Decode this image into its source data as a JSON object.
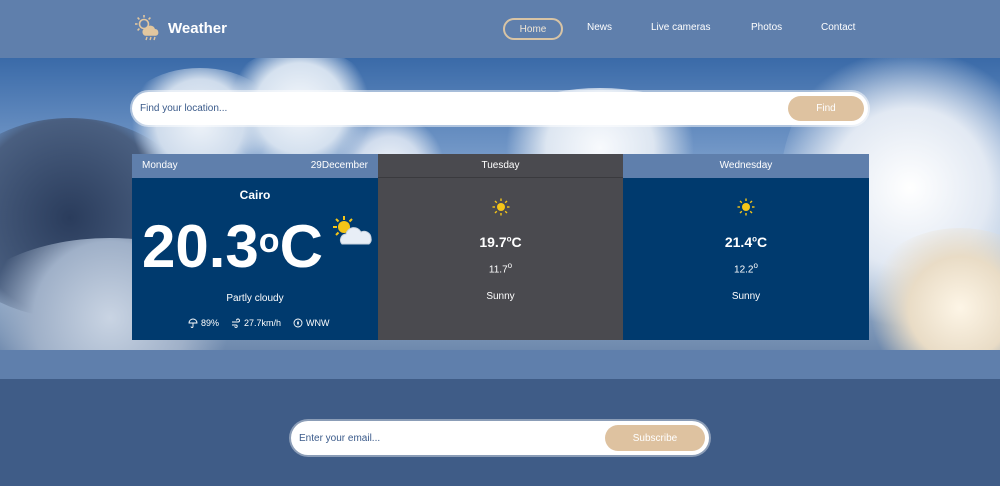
{
  "header": {
    "brand": "Weather",
    "nav": [
      {
        "label": "Home",
        "active": true
      },
      {
        "label": "News"
      },
      {
        "label": "Live cameras"
      },
      {
        "label": "Photos"
      },
      {
        "label": "Contact"
      }
    ]
  },
  "search": {
    "placeholder": "Find your location...",
    "button": "Find"
  },
  "forecast": {
    "today": {
      "day": "Monday",
      "date": "29December",
      "city": "Cairo",
      "temp": "20.3",
      "unit": "C",
      "condition": "Partly cloudy",
      "humidity": "89%",
      "wind_speed": "27.7km/h",
      "wind_dir": "WNW"
    },
    "days": [
      {
        "day": "Tuesday",
        "max": "19.7",
        "unit": "C",
        "min": "11.7",
        "condition": "Sunny"
      },
      {
        "day": "Wednesday",
        "max": "21.4",
        "unit": "C",
        "min": "12.2",
        "condition": "Sunny"
      }
    ]
  },
  "subscribe": {
    "placeholder": "Enter your email...",
    "button": "Subscribe"
  },
  "icons": {
    "logo": "sun-cloud-rain-icon",
    "today": "partly-cloudy-icon",
    "sunny": "sun-icon",
    "humidity": "umbrella-icon",
    "wind": "wind-icon",
    "compass": "compass-icon"
  },
  "colors": {
    "header": "#5f7fac",
    "accent": "#dec2a0",
    "card": "#003a6e",
    "card_active": "#4a4a4f",
    "background": "#3f5c87"
  }
}
